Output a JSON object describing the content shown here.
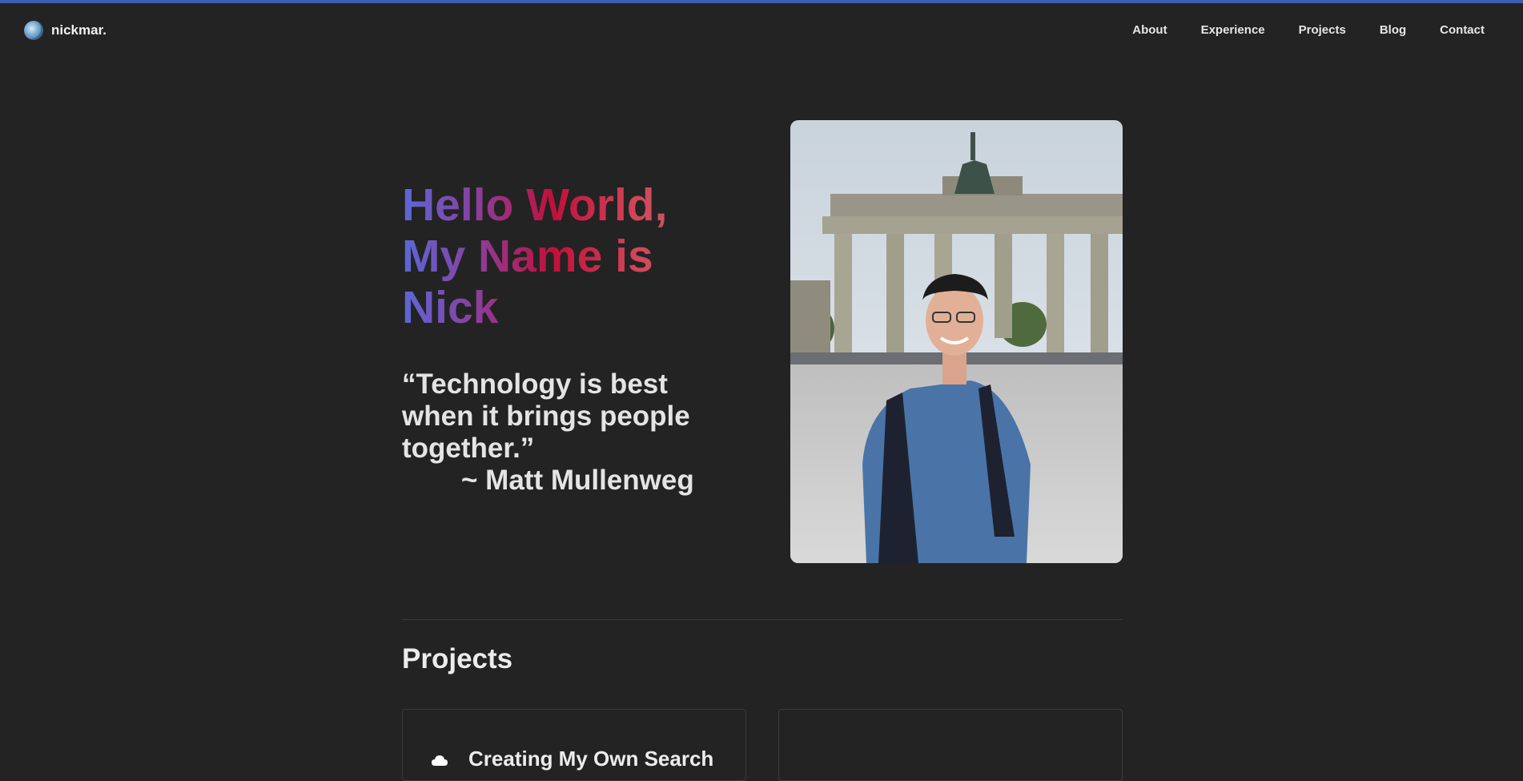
{
  "brand": {
    "name": "nickmar."
  },
  "nav": {
    "items": [
      {
        "label": "About"
      },
      {
        "label": "Experience"
      },
      {
        "label": "Projects"
      },
      {
        "label": "Blog"
      },
      {
        "label": "Contact"
      }
    ]
  },
  "hero": {
    "title_line1": "Hello World,",
    "title_line2": "My Name is",
    "title_line3": "Nick",
    "quote_text": "“Technology is best when it brings people together.”",
    "quote_author": "~ Matt Mullenweg"
  },
  "projects": {
    "heading": "Projects",
    "cards": [
      {
        "title": "Creating My Own Search"
      },
      {
        "title": ""
      }
    ]
  },
  "colors": {
    "background": "#232323",
    "top_accent": "#3d5fb0",
    "gradient_start": "#5b68d6",
    "gradient_mid": "#c1103a",
    "gradient_end": "#c06b75"
  }
}
